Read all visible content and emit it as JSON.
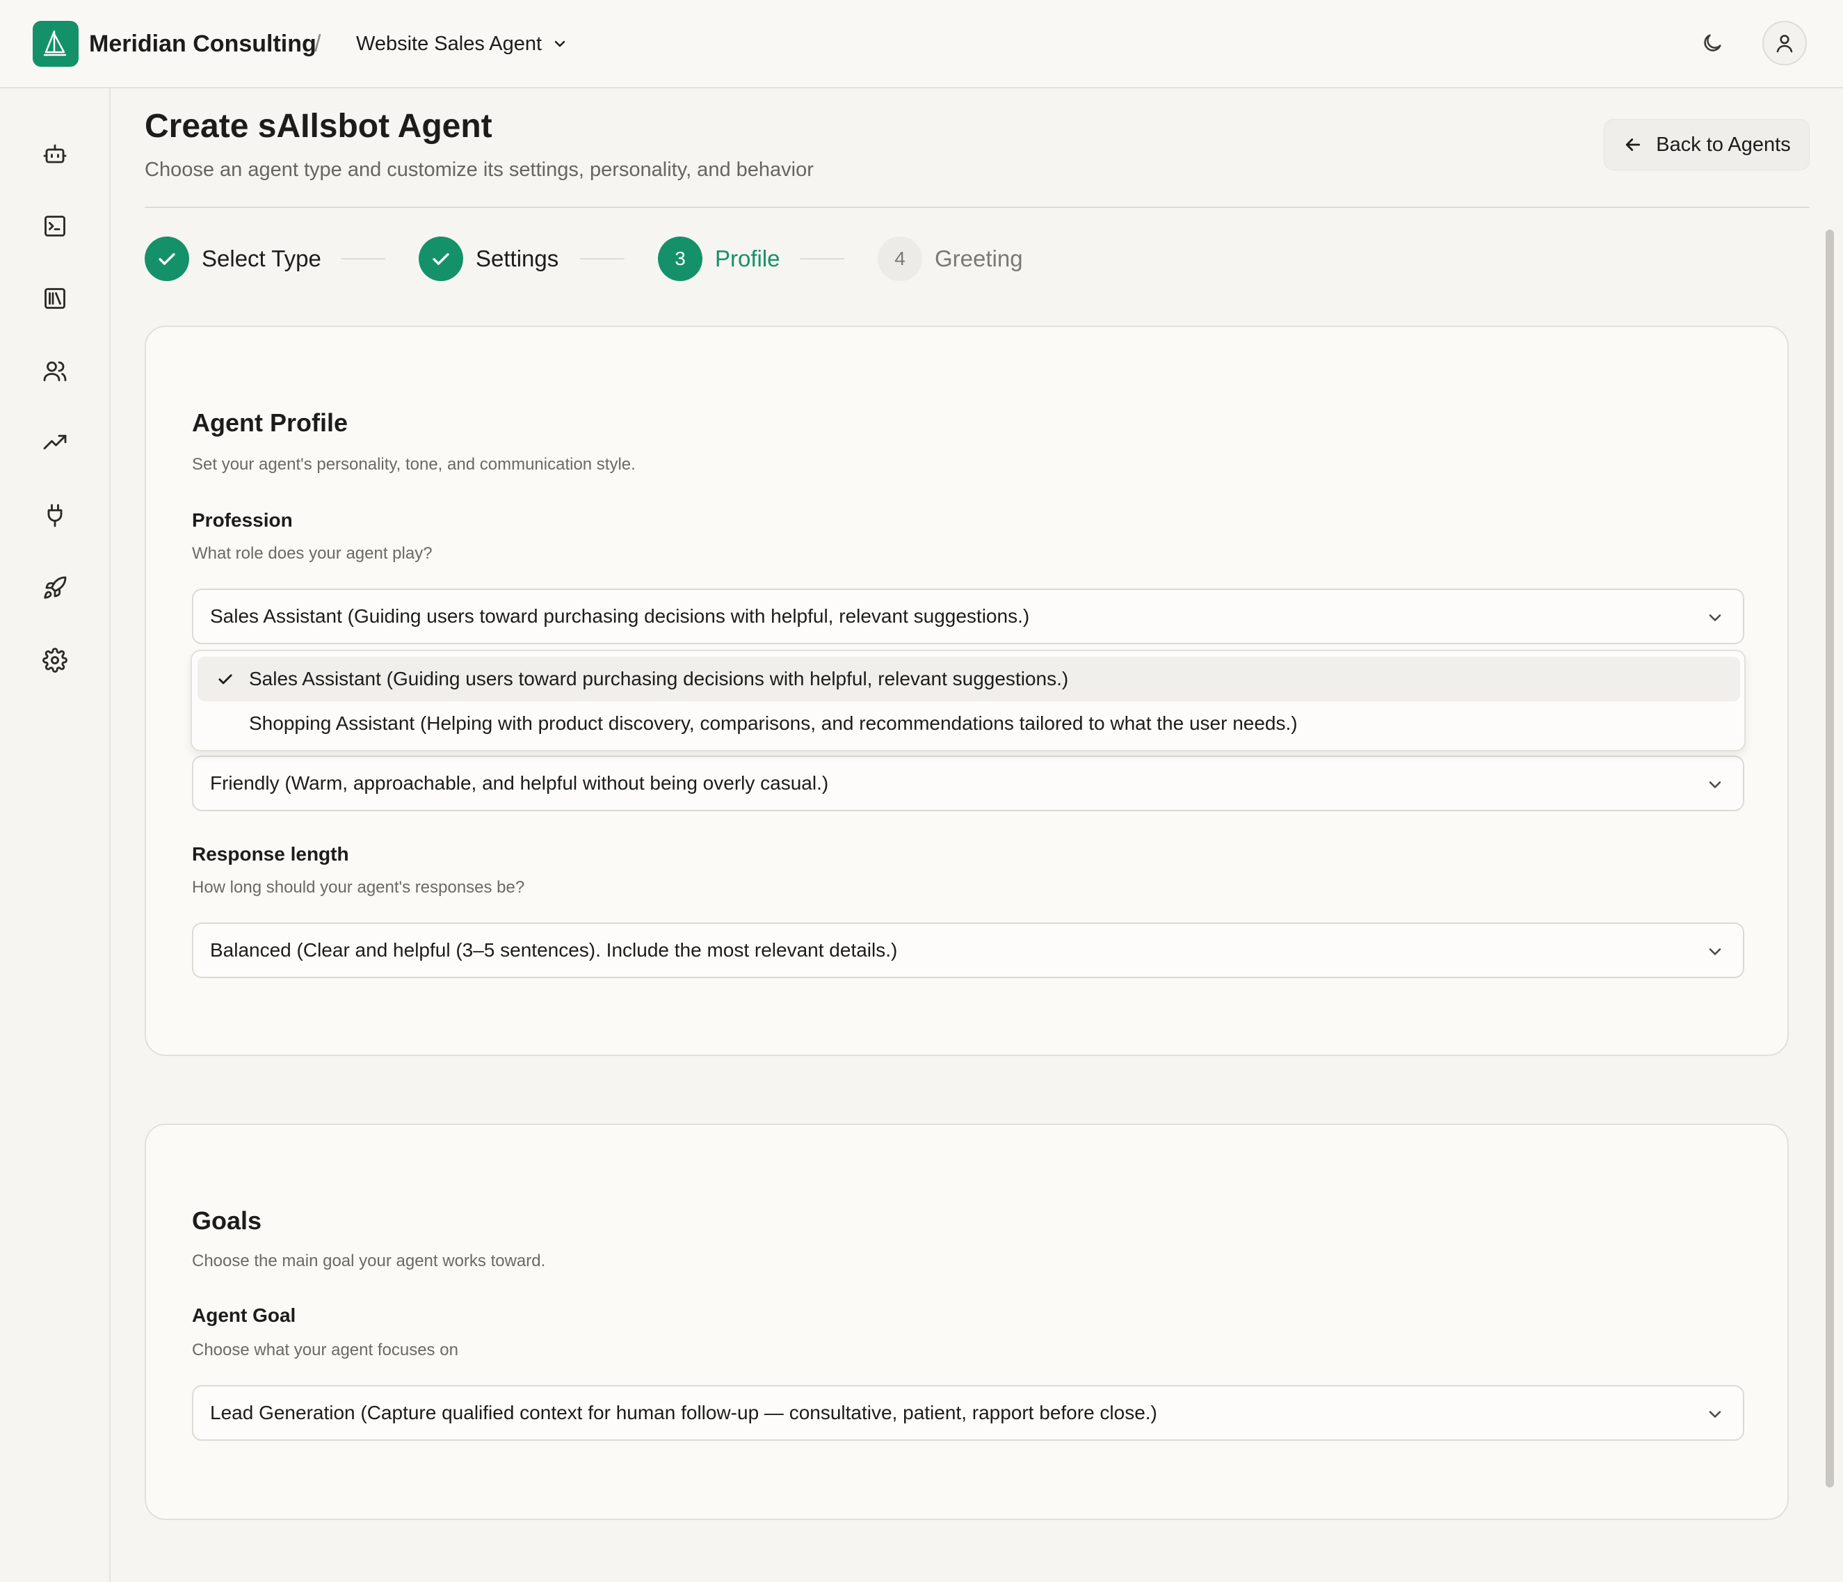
{
  "header": {
    "org_name": "Meridian Consulting",
    "separator": "/",
    "agent_name": "Website Sales Agent"
  },
  "sidebar": {
    "items": [
      {
        "icon": "bot-icon"
      },
      {
        "icon": "terminal-icon"
      },
      {
        "icon": "library-icon"
      },
      {
        "icon": "users-icon"
      },
      {
        "icon": "trending-up-icon"
      },
      {
        "icon": "plug-icon"
      },
      {
        "icon": "rocket-icon"
      },
      {
        "icon": "settings-icon"
      }
    ]
  },
  "page": {
    "title": "Create sAIlsbot Agent",
    "subtitle": "Choose an agent type and customize its settings, personality, and behavior",
    "back_label": "Back to Agents"
  },
  "stepper": {
    "steps": [
      {
        "label": "Select Type",
        "state": "done"
      },
      {
        "label": "Settings",
        "state": "done"
      },
      {
        "number": "3",
        "label": "Profile",
        "state": "active"
      },
      {
        "number": "4",
        "label": "Greeting",
        "state": "pending"
      }
    ]
  },
  "profile_card": {
    "title": "Agent Profile",
    "description": "Set your agent's personality, tone, and communication style.",
    "profession": {
      "label": "Profession",
      "help": "What role does your agent play?",
      "value": "Sales Assistant (Guiding users toward purchasing decisions with helpful, relevant suggestions.)",
      "options": [
        {
          "label": "Sales Assistant (Guiding users toward purchasing decisions with helpful, relevant suggestions.)",
          "selected": true
        },
        {
          "label": "Shopping Assistant (Helping with product discovery, comparisons, and recommendations tailored to what the user needs.)",
          "selected": false
        }
      ]
    },
    "tone": {
      "value": "Friendly (Warm, approachable, and helpful without being overly casual.)"
    },
    "response_length": {
      "label": "Response length",
      "help": "How long should your agent's responses be?",
      "value": "Balanced (Clear and helpful (3–5 sentences). Include the most relevant details.)"
    }
  },
  "goals_card": {
    "title": "Goals",
    "description": "Choose the main goal your agent works toward.",
    "agent_goal": {
      "label": "Agent Goal",
      "help": "Choose what your agent focuses on",
      "value": "Lead Generation (Capture qualified context for human follow-up — consultative, patient, rapport before close.)"
    }
  },
  "colors": {
    "accent": "#149169",
    "background": "#f6f5f2",
    "card": "#fbfaf7",
    "border": "#e2e0da",
    "muted_text": "#6a6963"
  }
}
